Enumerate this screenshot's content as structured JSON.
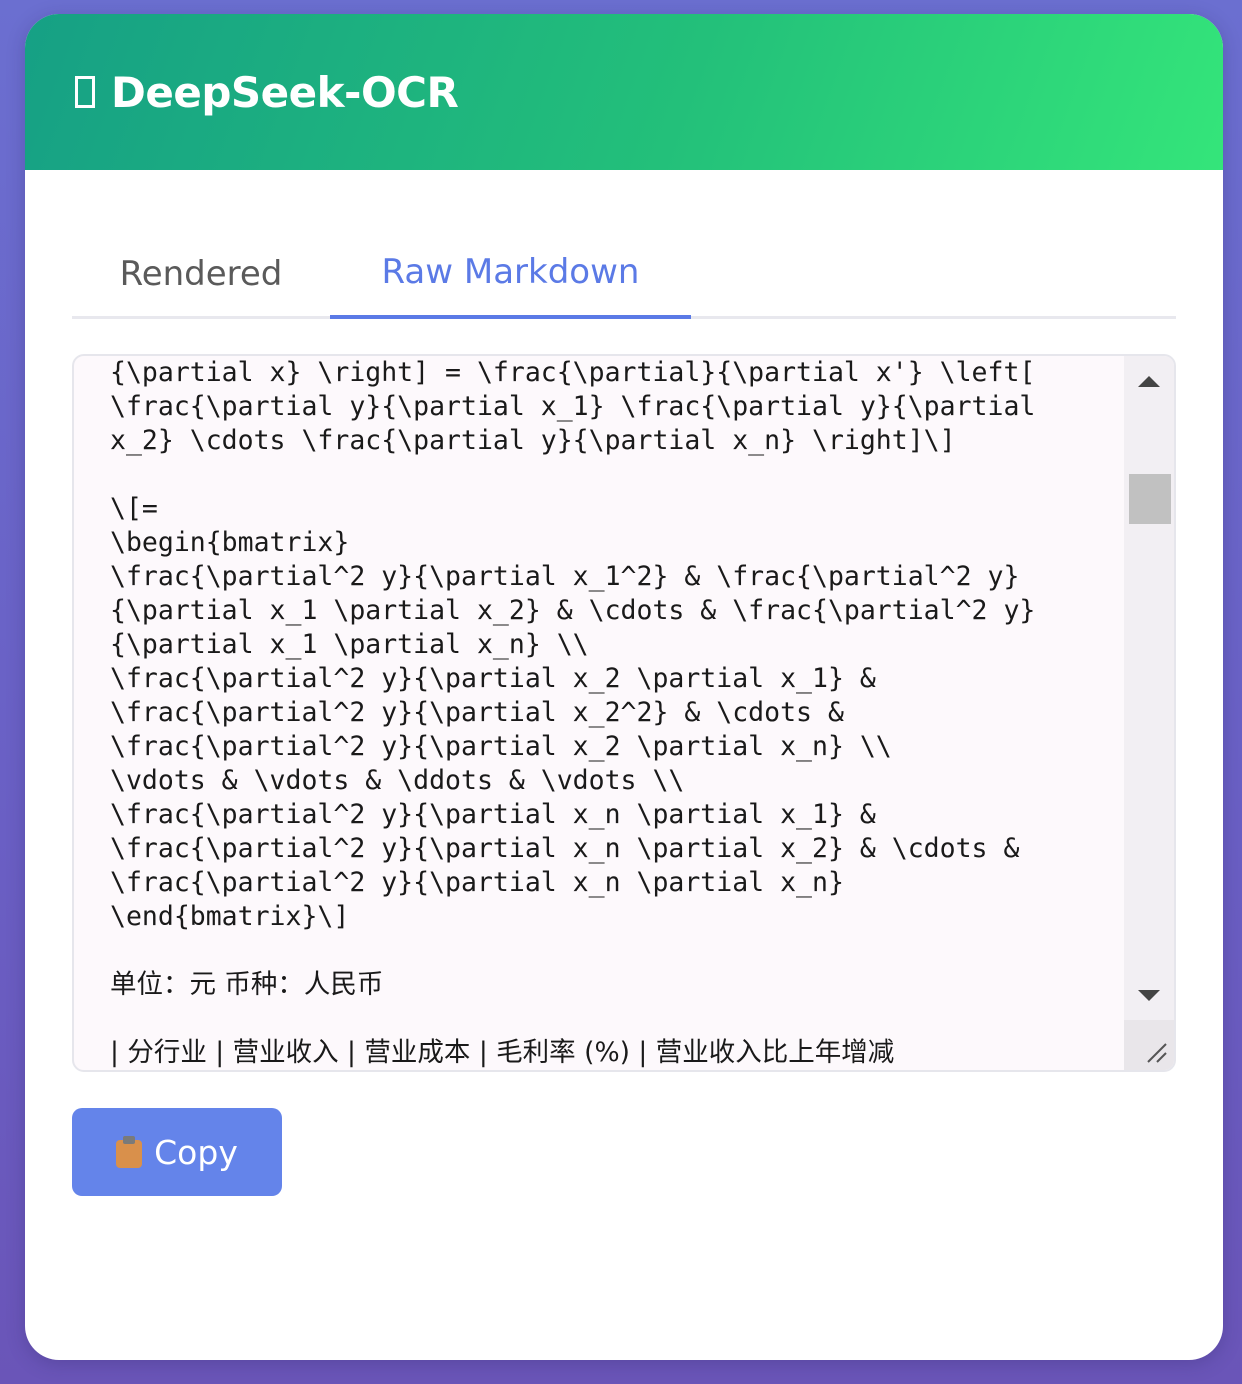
{
  "app": {
    "logo_glyph": "▯",
    "title": "DeepSeek-OCR",
    "header_colors": [
      "#16a085",
      "#34e57a"
    ]
  },
  "tabs": [
    {
      "label": "Rendered",
      "active": false
    },
    {
      "label": "Raw Markdown",
      "active": true
    }
  ],
  "accent_color": "#5b7ae6",
  "raw_markdown": {
    "lines": [
      "{\\partial x} \\right] = \\frac{\\partial}{\\partial x'} \\left[",
      "\\frac{\\partial y}{\\partial x_1} \\frac{\\partial y}{\\partial",
      "x_2} \\cdots \\frac{\\partial y}{\\partial x_n} \\right]\\]",
      "",
      "\\[=",
      "\\begin{bmatrix}",
      "\\frac{\\partial^2 y}{\\partial x_1^2} & \\frac{\\partial^2 y}",
      "{\\partial x_1 \\partial x_2} & \\cdots & \\frac{\\partial^2 y}",
      "{\\partial x_1 \\partial x_n} \\\\",
      "\\frac{\\partial^2 y}{\\partial x_2 \\partial x_1} &",
      "\\frac{\\partial^2 y}{\\partial x_2^2} & \\cdots &",
      "\\frac{\\partial^2 y}{\\partial x_2 \\partial x_n} \\\\",
      "\\vdots & \\vdots & \\ddots & \\vdots \\\\",
      "\\frac{\\partial^2 y}{\\partial x_n \\partial x_1} &",
      "\\frac{\\partial^2 y}{\\partial x_n \\partial x_2} & \\cdots &",
      "\\frac{\\partial^2 y}{\\partial x_n \\partial x_n}",
      "\\end{bmatrix}\\]",
      "",
      "单位：元 币种：人民币",
      "",
      "| 分行业 | 营业收入 | 营业成本 | 毛利率 (%) | 营业收入比上年增减"
    ]
  },
  "copy_button": {
    "icon": "clipboard-icon",
    "label": "Copy"
  }
}
